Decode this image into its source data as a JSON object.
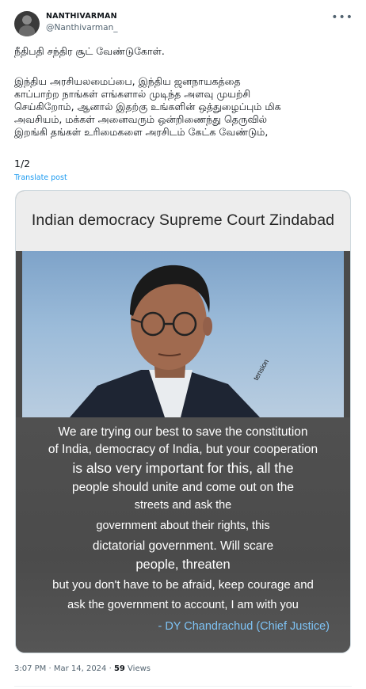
{
  "author": {
    "display_name": "NANTHIVARMAN",
    "handle": "@Nanthivarman_"
  },
  "menu_icon": "more-dots-icon",
  "tweet": {
    "line1": "நீதிபதி சந்திர சூட் வேண்டுகோள்.",
    "para2_l1": "இந்திய அரசியலமைப்பை, இந்திய ஜனநாயகத்தை",
    "para2_l2": "காப்பாற்ற நாங்கள் எங்களால் முடிந்த அளவு முயற்சி",
    "para2_l3": "செய்கிறோம், ஆனால் இதற்கு உங்களின் ஒத்துழைப்பும் மிக",
    "para2_l4": "அவசியம், மக்கள் அனைவரும் ஒன்றிணைந்து தெருவில்",
    "para2_l5": "இறங்கி தங்கள் உரிமைகளை அரசிடம் கேட்க வேண்டும்,",
    "counter": "1/2",
    "translate_label": "Translate post"
  },
  "media": {
    "title": "Indian democracy Supreme Court Zindabad",
    "photo_tag": "tension",
    "caption": [
      "We are trying our best to save the constitution",
      "of India, democracy of India, but your cooperation",
      "is also very important for this, all the",
      "people should unite and come out on the",
      "streets and ask the",
      "government about their rights, this",
      "dictatorial government. Will scare",
      "people, threaten",
      "but you don't have to be afraid, keep courage and",
      "ask the government to account, I am with you"
    ],
    "signature": "- DY Chandrachud (Chief Justice)"
  },
  "meta": {
    "time": "3:07 PM · Mar 14, 2024 · ",
    "views_count": "59",
    "views_label": " Views"
  }
}
